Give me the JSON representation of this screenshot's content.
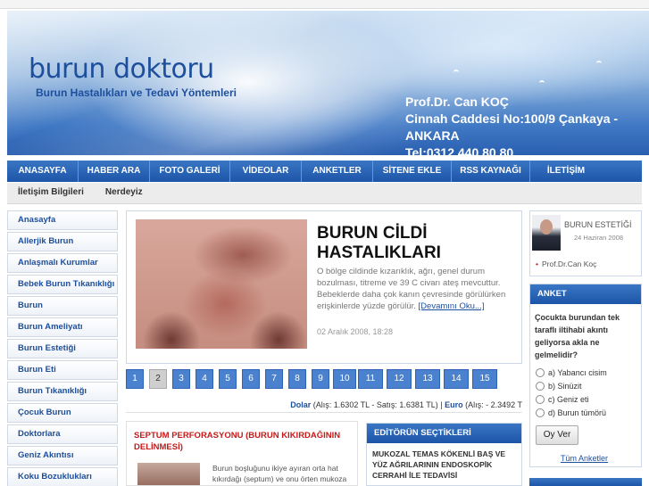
{
  "header": {
    "logo": "burun doktoru",
    "tagline": "Burun Hastalıkları ve Tedavi Yöntemleri",
    "contact_name": "Prof.Dr. Can KOÇ",
    "contact_address": "Cinnah Caddesi No:100/9 Çankaya - ANKARA",
    "contact_phone": "Tel:0312 440 80 80"
  },
  "nav": {
    "items": [
      {
        "label": "ANASAYFA"
      },
      {
        "label": "HABER ARA"
      },
      {
        "label": "FOTO GALERİ"
      },
      {
        "label": "VİDEOLAR"
      },
      {
        "label": "ANKETLER"
      },
      {
        "label": "SİTENE EKLE"
      },
      {
        "label": "RSS KAYNAĞI"
      },
      {
        "label": "İLETİŞİM"
      }
    ]
  },
  "subnav": {
    "items": [
      {
        "label": "İletişim Bilgileri"
      },
      {
        "label": "Nerdeyiz"
      }
    ]
  },
  "sidebar": {
    "items": [
      {
        "label": "Anasayfa"
      },
      {
        "label": "Allerjik Burun"
      },
      {
        "label": "Anlaşmalı Kurumlar"
      },
      {
        "label": "Bebek Burun Tıkanıklığı"
      },
      {
        "label": "Burun"
      },
      {
        "label": "Burun Ameliyatı"
      },
      {
        "label": "Burun Estetiği"
      },
      {
        "label": "Burun Eti"
      },
      {
        "label": "Burun Tıkanıklığı"
      },
      {
        "label": "Çocuk Burun"
      },
      {
        "label": "Doktorlara"
      },
      {
        "label": "Geniz Akıntısı"
      },
      {
        "label": "Koku Bozuklukları"
      }
    ]
  },
  "feature": {
    "title": "BURUN CİLDİ HASTALIKLARI",
    "text": "O bölge cildinde kızarıklık, ağrı, genel durum bozulması, titreme ve 39 C civarı ateş mevcuttur. Bebeklerde daha çok kanın çevresinde görülürken erişkinlerde yüzde görülür.",
    "more": "[Devamını Oku...]",
    "date": "02 Aralık 2008, 18:28"
  },
  "pager": {
    "pages": [
      "1",
      "2",
      "3",
      "4",
      "5",
      "6",
      "7",
      "8",
      "9",
      "10",
      "11",
      "12",
      "13",
      "14",
      "15"
    ],
    "active": "2"
  },
  "currency": {
    "dollar": "Dolar",
    "dollar_values": "(Alış: 1.6302 TL - Satış: 1.6381 TL)",
    "separator": "|",
    "euro": "Euro",
    "euro_values": "(Alış: - 2.3492 T"
  },
  "article2": {
    "title": "SEPTUM PERFORASYONU (BURUN KIKIRDAĞININ DELİNMESİ)",
    "text": "Burun boşluğunu ikiye ayıran orta hat kıkırdağı (septum) ve onu örten mukoza"
  },
  "editor": {
    "heading": "EDİTÖRÜN SEÇTİKLERİ",
    "item": "MUKOZAL TEMAS KÖKENLİ BAŞ VE YÜZ AĞRILARININ ENDOSKOPİK CERRAHİ İLE TEDAVİSİ"
  },
  "aesthetic": {
    "title": "BURUN ESTETİĞİ",
    "date": "24 Haziran 2008",
    "author": "Prof.Dr.Can Koç"
  },
  "poll": {
    "heading": "ANKET",
    "question": "Çocukta burundan tek taraflı iltihabi akıntı geliyorsa akla ne gelmelidir?",
    "options": [
      {
        "label": "a) Yabancı cisim"
      },
      {
        "label": "b) Sinüzit"
      },
      {
        "label": "c) Geniz eti"
      },
      {
        "label": "d) Burun tümörü"
      }
    ],
    "vote_label": "Oy Ver",
    "all_label": "Tüm Anketler"
  },
  "colors": {
    "brand_blue": "#1d55a8",
    "link_blue": "#1d4e9c",
    "alert_red": "#c41a1a"
  }
}
